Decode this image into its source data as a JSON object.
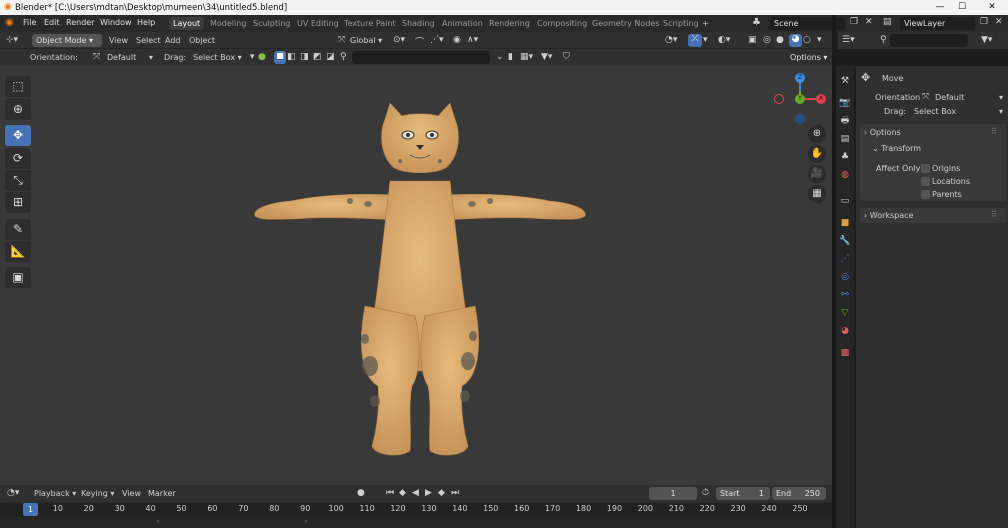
{
  "titlebar": {
    "title": "Blender* [C:\\Users\\mdtan\\Desktop\\mumeen\\34\\untitled5.blend]",
    "minimize": "—",
    "maximize": "☐",
    "close": "✕"
  },
  "menus": [
    "File",
    "Edit",
    "Render",
    "Window",
    "Help"
  ],
  "workspaces": [
    "Layout",
    "Modeling",
    "Sculpting",
    "UV Editing",
    "Texture Paint",
    "Shading",
    "Animation",
    "Rendering",
    "Compositing",
    "Geometry Nodes",
    "Scripting",
    "+"
  ],
  "scene": {
    "name": "Scene",
    "viewlayer": "ViewLayer"
  },
  "viewport_header": {
    "mode": "Object Mode",
    "menus": [
      "View",
      "Select",
      "Add",
      "Object"
    ],
    "transform": "Global",
    "options": "Options"
  },
  "tool_header": {
    "orientation_label": "Orientation:",
    "orientation_value": "Default",
    "drag_label": "Drag:",
    "drag_value": "Select Box"
  },
  "gizmo": {
    "z": "Z",
    "y": "Y",
    "x": "X"
  },
  "timeline": {
    "menus": [
      "Playback",
      "Keying",
      "View",
      "Marker"
    ],
    "current_frame": "1",
    "start_label": "Start",
    "start": "1",
    "end_label": "End",
    "end": "250",
    "ticks": [
      "1",
      "10",
      "20",
      "30",
      "40",
      "50",
      "60",
      "70",
      "80",
      "90",
      "100",
      "110",
      "120",
      "130",
      "140",
      "150",
      "160",
      "170",
      "180",
      "190",
      "200",
      "210",
      "220",
      "230",
      "240",
      "250"
    ]
  },
  "properties": {
    "tool_name": "Move",
    "orientation_label": "Orientation",
    "orientation_value": "Default",
    "drag_label": "Drag:",
    "drag_value": "Select Box",
    "options_title": "Options",
    "transform_title": "Transform",
    "affect_only_label": "Affect Only",
    "affect": [
      "Origins",
      "Locations",
      "Parents"
    ],
    "workspace_title": "Workspace"
  },
  "colors": {
    "accent": "#4772b3",
    "x_axis": "#e04050",
    "y_axis": "#6bab2a",
    "z_axis": "#3a8de0",
    "fur": "#d9a866"
  }
}
